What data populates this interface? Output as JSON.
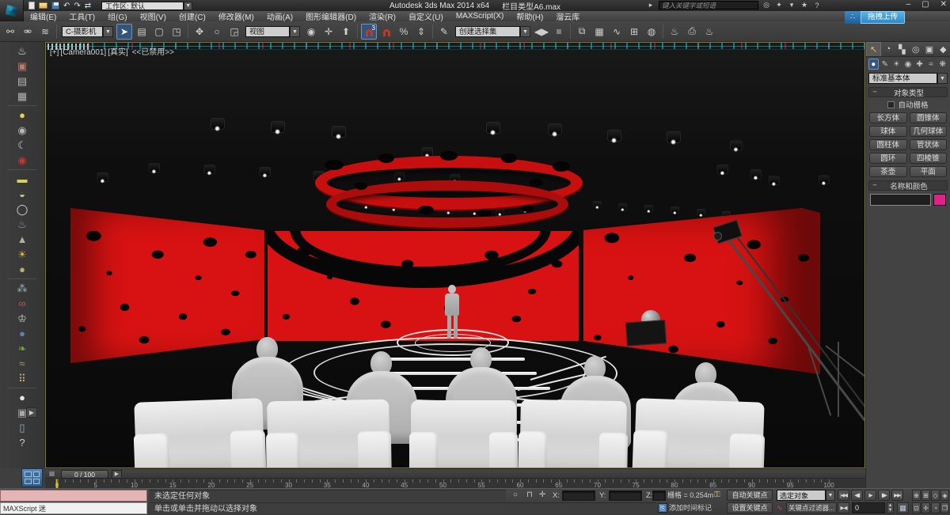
{
  "window": {
    "title_left": "Autodesk 3ds Max 2014 x64",
    "title_right": "栏目类型A6.max",
    "workspace": "工作区: 默认",
    "search_placeholder": "键入关键字或短语",
    "upload_badge": "拖拽上传"
  },
  "menu": {
    "items": [
      "编辑(E)",
      "工具(T)",
      "组(G)",
      "视图(V)",
      "创建(C)",
      "修改器(M)",
      "动画(A)",
      "图形编辑器(D)",
      "渲染(R)",
      "自定义(U)",
      "MAXScript(X)",
      "帮助(H)",
      "溜云库"
    ]
  },
  "toolbar": {
    "selection_filter": "C-摄影机",
    "ref_coord": "视图",
    "named_sets": "创建选择集",
    "snap_label": "3"
  },
  "viewport": {
    "label_plus": "[+]",
    "label_camera": "[Camera001]",
    "label_shading": "[真实]",
    "label_disabled": "<<已禁用>>"
  },
  "command_panel": {
    "dropdown": "标准基本体",
    "rollout_object_type": "对象类型",
    "autogrid": "自动栅格",
    "buttons": [
      "长方体",
      "圆锥体",
      "球体",
      "几何球体",
      "圆柱体",
      "管状体",
      "圆环",
      "四棱锥",
      "茶壶",
      "平面"
    ],
    "rollout_name_color": "名称和颜色"
  },
  "timeline": {
    "display": "0 / 100",
    "start": 0,
    "end": 100,
    "label_step": 5
  },
  "status": {
    "listener_label": "MAXScript 迷",
    "line1": "未选定任何对象",
    "line2": "单击或单击并拖动以选择对象",
    "x_label": "X:",
    "y_label": "Y:",
    "z_label": "Z:",
    "grid": "栅格 = 0.254m",
    "add_time_tag": "添加时间标记",
    "auto_key": "自动关键点",
    "set_key": "设置关键点",
    "selection_set": "选定对象",
    "key_filters": "关键点过滤器...",
    "frame": "0"
  },
  "colors": {
    "accent_red": "#d81212",
    "swatch_magenta": "#e0218a",
    "active_blue": "#35547a",
    "marker_yellow": "#d8c21a"
  }
}
